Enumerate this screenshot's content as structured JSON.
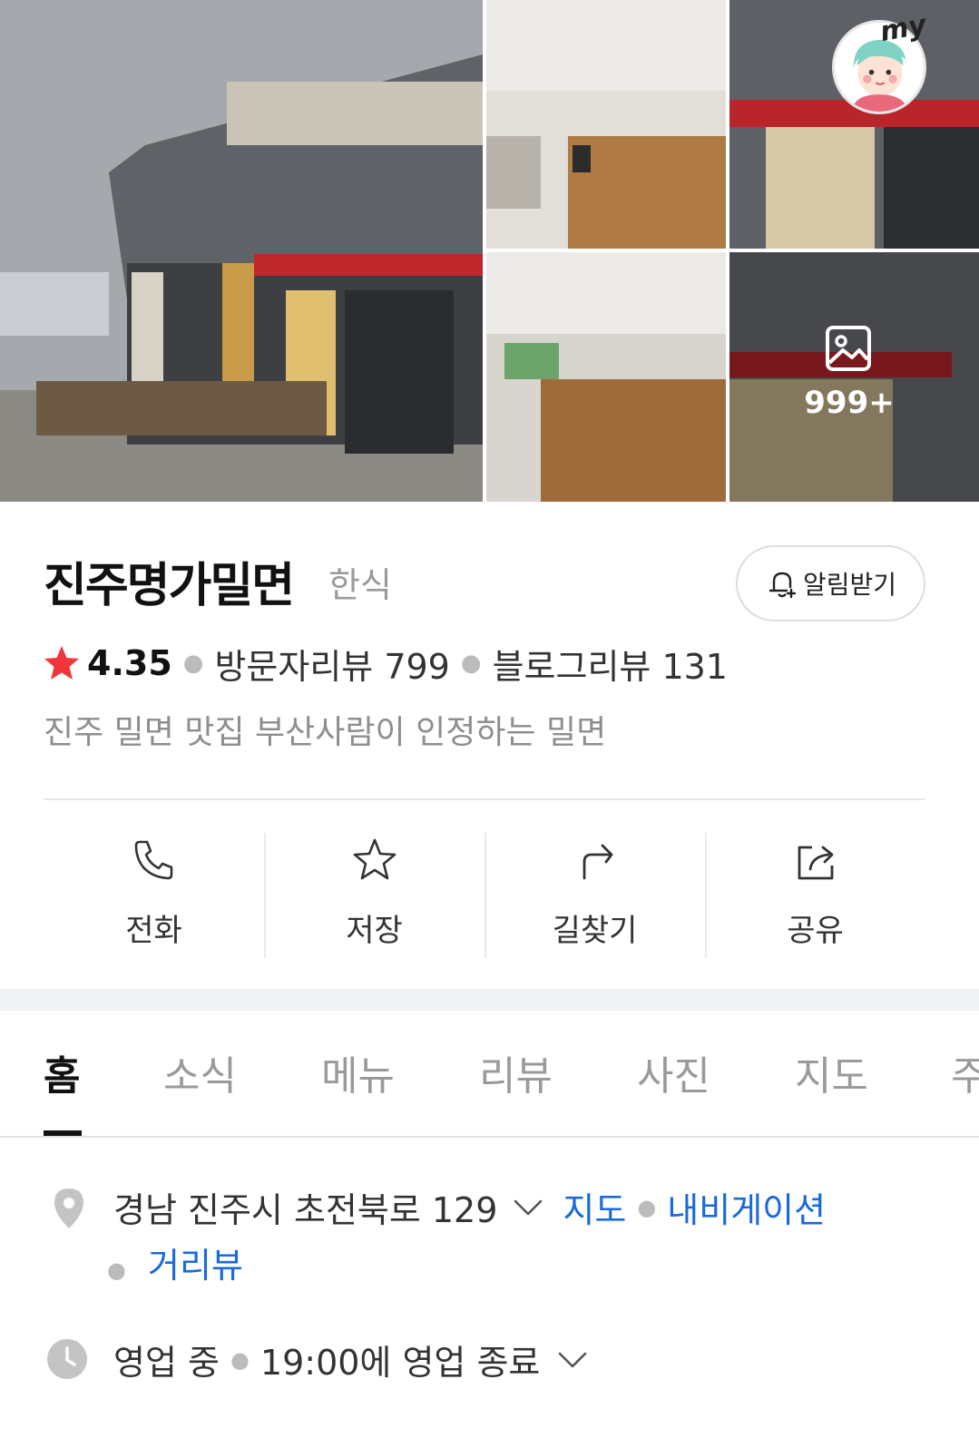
{
  "photos": {
    "more_count": "999+",
    "my_badge": "my"
  },
  "place": {
    "name": "진주명가밀면",
    "category": "한식",
    "notify_label": "알림받기",
    "rating": "4.35",
    "visitor_reviews": "방문자리뷰 799",
    "blog_reviews": "블로그리뷰 131",
    "description": "진주 밀면 맛집 부산사람이 인정하는 밀면"
  },
  "actions": {
    "call": "전화",
    "save": "저장",
    "directions": "길찾기",
    "share": "공유"
  },
  "tabs": {
    "home": "홈",
    "news": "소식",
    "menu": "메뉴",
    "review": "리뷰",
    "photo": "사진",
    "map": "지도",
    "more": "주"
  },
  "info": {
    "address": "경남 진주시 초전북로 129",
    "map_link": "지도",
    "navigation_link": "내비게이션",
    "streetview_link": "거리뷰",
    "status": "영업 중",
    "hours": "19:00에 영업 종료"
  },
  "colors": {
    "link": "#1a6ad9",
    "star": "#f0363c",
    "icon_gray": "#c4c4c4"
  }
}
